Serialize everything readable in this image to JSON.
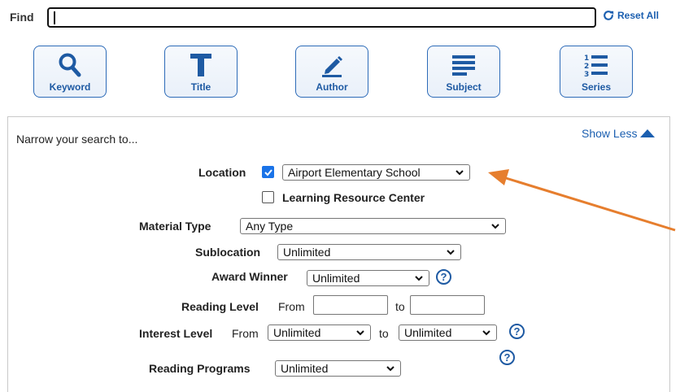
{
  "find": {
    "label": "Find",
    "value": "",
    "reset_label": "Reset All"
  },
  "search_types": [
    {
      "label": "Keyword",
      "icon": "magnifier-icon"
    },
    {
      "label": "Title",
      "icon": "title-t-icon"
    },
    {
      "label": "Author",
      "icon": "pencil-icon"
    },
    {
      "label": "Subject",
      "icon": "lines-icon"
    },
    {
      "label": "Series",
      "icon": "numbered-list-icon"
    }
  ],
  "narrow": {
    "title": "Narrow your search to...",
    "show_less": "Show Less",
    "location": {
      "label": "Location",
      "checked": true,
      "selected": "Airport Elementary School"
    },
    "lrc": {
      "label": "Learning Resource Center",
      "checked": false
    },
    "material_type": {
      "label": "Material Type",
      "selected": "Any Type"
    },
    "sublocation": {
      "label": "Sublocation",
      "selected": "Unlimited"
    },
    "award_winner": {
      "label": "Award Winner",
      "selected": "Unlimited"
    },
    "reading_level": {
      "label": "Reading Level",
      "from": "From",
      "to": "to",
      "from_value": "",
      "to_value": ""
    },
    "interest_level": {
      "label": "Interest Level",
      "from": "From",
      "to": "to",
      "from_selected": "Unlimited",
      "to_selected": "Unlimited"
    },
    "reading_programs": {
      "label": "Reading Programs",
      "selected": "Unlimited"
    }
  },
  "colors": {
    "accent": "#1e5aa3",
    "link": "#1b5fb0",
    "checkbox": "#1a73e8",
    "annotation_arrow": "#e67e2e"
  }
}
